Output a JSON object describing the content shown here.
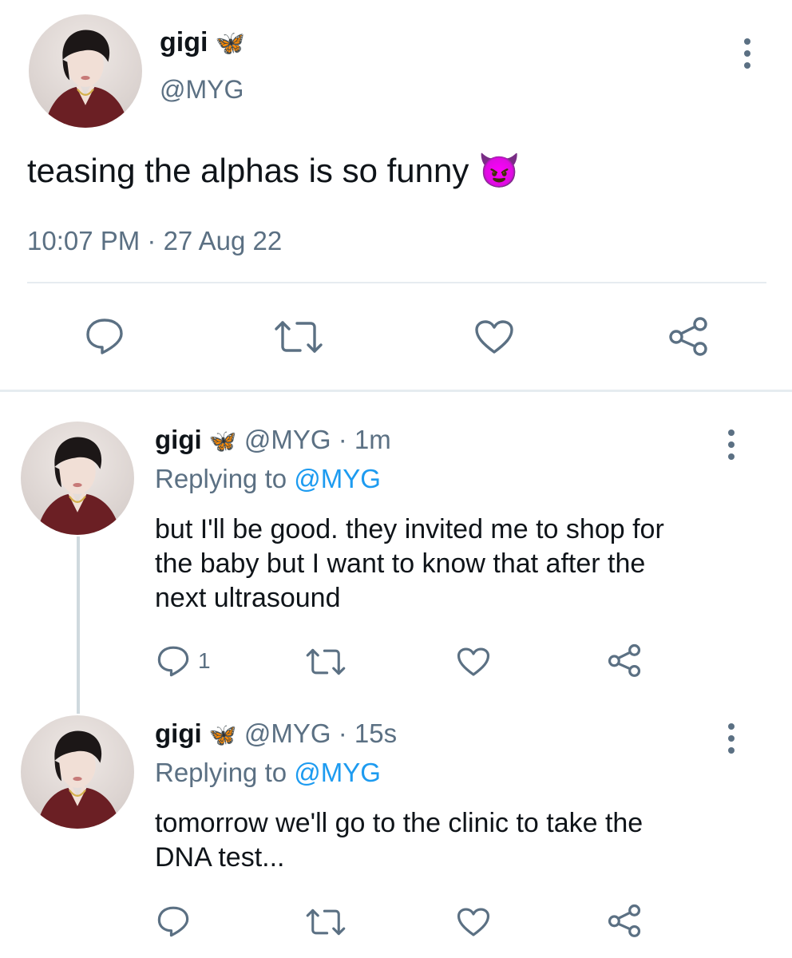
{
  "main_tweet": {
    "display_name": "gigi",
    "name_emoji": "🦋",
    "handle": "@MYG",
    "text": "teasing the alphas is so funny",
    "text_emoji": "😈",
    "timestamp": "10:07 PM · 27 Aug 22",
    "icons": [
      "reply-icon",
      "retweet-icon",
      "like-icon",
      "share-icon"
    ]
  },
  "replies": [
    {
      "display_name": "gigi",
      "name_emoji": "🦋",
      "handle": "@MYG",
      "separator": "·",
      "time": "1m",
      "replying_prefix": "Replying to ",
      "replying_handle": "@MYG",
      "text_lines": [
        "but I'll be good. they invited me to shop for",
        "the baby but I want to know that after the",
        "next ultrasound"
      ],
      "reply_count": "1"
    },
    {
      "display_name": "gigi",
      "name_emoji": "🦋",
      "handle": "@MYG",
      "separator": "·",
      "time": "15s",
      "replying_prefix": "Replying to ",
      "replying_handle": "@MYG",
      "text_lines": [
        "tomorrow we'll go to the clinic to take the",
        "DNA test..."
      ],
      "reply_count": ""
    }
  ],
  "colors": {
    "text": "#0f1419",
    "secondary": "#5b7083",
    "link": "#1d9bf0",
    "divider": "#e6ecf0"
  }
}
